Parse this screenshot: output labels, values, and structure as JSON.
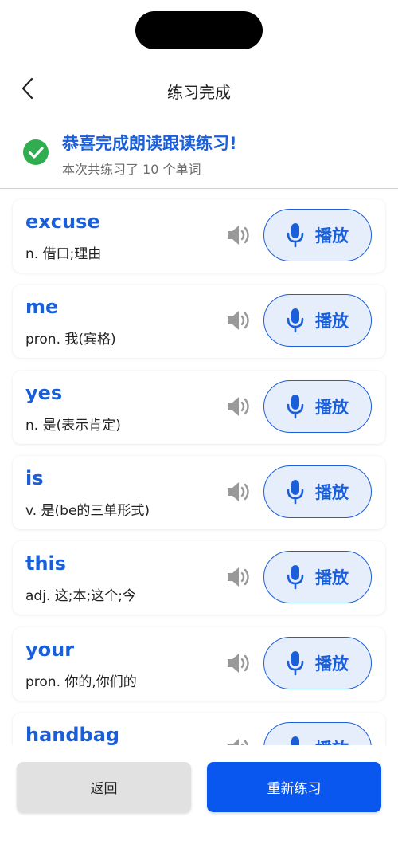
{
  "header": {
    "title": "练习完成",
    "back_icon": "chevron-left-icon"
  },
  "banner": {
    "title": "恭喜完成朗读跟读练习!",
    "subtitle": "本次共练习了 10 个单词",
    "icon": "check-circle-icon"
  },
  "words": [
    {
      "word": "excuse",
      "meaning": "n. 借口;理由",
      "play_label": "播放"
    },
    {
      "word": "me",
      "meaning": "pron. 我(宾格)",
      "play_label": "播放"
    },
    {
      "word": "yes",
      "meaning": "n. 是(表示肯定)",
      "play_label": "播放"
    },
    {
      "word": "is",
      "meaning": "v. 是(be的三单形式)",
      "play_label": "播放"
    },
    {
      "word": "this",
      "meaning": "adj. 这;本;这个;今",
      "play_label": "播放"
    },
    {
      "word": "your",
      "meaning": "pron. 你的,你们的",
      "play_label": "播放"
    },
    {
      "word": "handbag",
      "meaning": "",
      "play_label": "播放"
    }
  ],
  "footer": {
    "back_label": "返回",
    "retry_label": "重新练习"
  },
  "colors": {
    "accent": "#1a5fd9",
    "primary_button": "#0a57f0",
    "success": "#2fad4f",
    "secondary_button": "#e1e1e1"
  }
}
